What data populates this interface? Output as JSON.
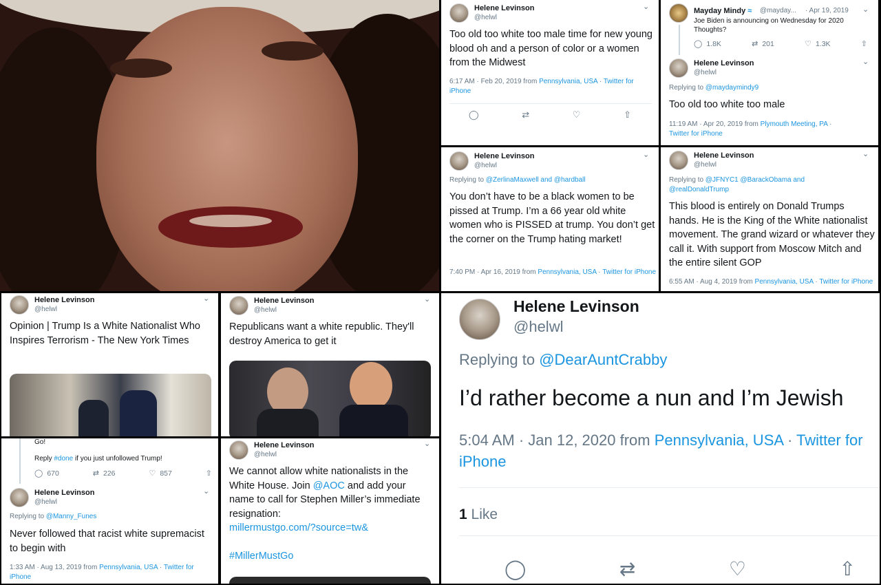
{
  "profile": {
    "name": "Helene Levinson",
    "handle": "@helwl"
  },
  "icons": {
    "reply": "reply-icon",
    "retweet": "retweet-icon",
    "like": "heart-icon",
    "share": "share-icon",
    "chevron": "chevron-down-icon",
    "verified": "wave-badge-icon"
  },
  "colors": {
    "link": "#1b95e0",
    "meta": "#657786",
    "text": "#14171a"
  },
  "tweet1": {
    "text": "Too old too white too male  time for new young blood oh and a person of color or a women from the Midwest",
    "meta_prefix": "6:17 AM · Feb 20, 2019 from ",
    "meta_loc": "Pennsylvania, USA",
    "meta_sep": " · ",
    "meta_client": "Twitter for iPhone"
  },
  "tweet2": {
    "parent_name": "Mayday Mindy",
    "parent_handle": "@mayday...",
    "parent_date": "· Apr 19, 2019",
    "parent_text": "Joe Biden is announcing on Wednesday for 2020 Thoughts?",
    "parent_replies": "1.8K",
    "parent_retweets": "201",
    "parent_likes": "1.3K",
    "replying_prefix": "Replying to ",
    "replying_to": "@maydaymindy9",
    "text": "Too old too white too male",
    "meta_prefix": "11:19 AM · Apr 20, 2019 from ",
    "meta_loc": "Plymouth Meeting, PA",
    "meta_sep": " · ",
    "meta_client": "Twitter for iPhone"
  },
  "tweet3": {
    "replying_prefix": "Replying to ",
    "replying_to": "@ZerlinaMaxwell and @hardball",
    "text": "You don’t have to be a black women to be pissed at Trump. I’m a 66 year old white women who is PISSED at trump. You don’t get the corner on the Trump hating market!",
    "meta_prefix": "7:40 PM · Apr 16, 2019 from ",
    "meta_loc": "Pennsylvania, USA",
    "meta_sep": " · ",
    "meta_client": "Twitter for iPhone"
  },
  "tweet4": {
    "replying_prefix": "Replying to ",
    "replying_to": "@JFNYC1 @BarackObama and @realDonaldTrump",
    "text": "This blood is entirely on Donald Trumps hands.  He is the King  of the White nationalist movement. The grand wizard or whatever they call it. With support from Moscow Mitch and the entire silent GOP",
    "meta_prefix": "6:55 AM · Aug 4, 2019 from ",
    "meta_loc": "Pennsylvania, USA",
    "meta_sep": " · ",
    "meta_client": "Twitter for iPhone"
  },
  "tweet5": {
    "text": "Opinion | Trump Is a White Nationalist Who Inspires Terrorism - The New York Times"
  },
  "tweet6": {
    "text": "Republicans want a white republic. They'll destroy America to get it"
  },
  "tweet7": {
    "parent_tail": "Go!",
    "parent_text_prefix": "Reply ",
    "parent_hashtag": "#done",
    "parent_text_suffix": " if you just unfollowed Trump!",
    "parent_replies": "670",
    "parent_retweets": "226",
    "parent_likes": "857",
    "replying_prefix": "Replying to ",
    "replying_to": "@Manny_Funes",
    "text": "Never followed that racist white supremacist to begin with",
    "meta_prefix": "1:33 AM · Aug 13, 2019 from ",
    "meta_loc": "Pennsylvania, USA",
    "meta_sep": " · ",
    "meta_client": "Twitter for iPhone"
  },
  "tweet8": {
    "text_a": "We cannot allow white nationalists in the White House. Join ",
    "mention": "@AOC",
    "text_b": " and add your name to call for Stephen Miller’s immediate resignation:",
    "url": "millermustgo.com/?source=tw&",
    "hashtag": "#MillerMustGo"
  },
  "tweet9": {
    "replying_prefix": "Replying to ",
    "replying_to": "@DearAuntCrabby",
    "text": "I’d rather become a nun and I’m Jewish",
    "meta_prefix": "5:04 AM · Jan 12, 2020 from ",
    "meta_loc": "Pennsylvania, USA",
    "meta_sep": " · ",
    "meta_client": "Twitter for iPhone",
    "likes_count": "1",
    "likes_label": " Like"
  }
}
